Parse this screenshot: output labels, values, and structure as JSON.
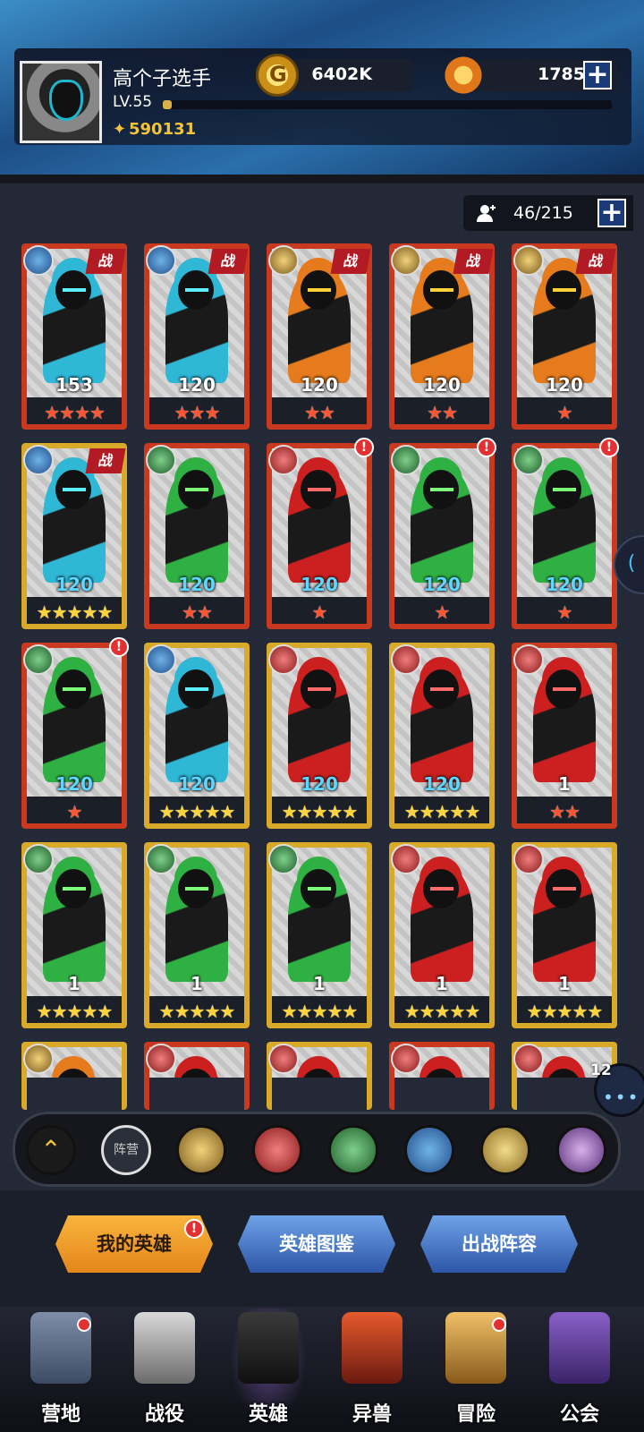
{
  "player": {
    "name": "高个子选手",
    "level": "LV.55",
    "xp_fraction": 0.02,
    "power": "590131"
  },
  "currencies": {
    "gold": "6402K",
    "gems": "1785"
  },
  "roster": {
    "capacity": "46/215"
  },
  "heroes": [
    {
      "level": "153",
      "stars": 4,
      "star_color": "red",
      "faction": "water",
      "battle": true,
      "alert": false,
      "frame": "red",
      "theme": "cyan"
    },
    {
      "level": "120",
      "stars": 3,
      "star_color": "red",
      "faction": "water",
      "battle": true,
      "alert": false,
      "frame": "red",
      "theme": "cyan"
    },
    {
      "level": "120",
      "stars": 2,
      "star_color": "red",
      "faction": "sun",
      "battle": true,
      "alert": false,
      "frame": "red",
      "theme": "orange"
    },
    {
      "level": "120",
      "stars": 2,
      "star_color": "red",
      "faction": "sun",
      "battle": true,
      "alert": false,
      "frame": "red",
      "theme": "orange"
    },
    {
      "level": "120",
      "stars": 1,
      "star_color": "red",
      "faction": "sun",
      "battle": true,
      "alert": false,
      "frame": "red",
      "theme": "orange"
    },
    {
      "level": "120",
      "stars": 5,
      "star_color": "gold",
      "faction": "water",
      "battle": true,
      "alert": false,
      "frame": "gold",
      "theme": "cyan"
    },
    {
      "level": "120",
      "stars": 2,
      "star_color": "red",
      "faction": "nature",
      "battle": false,
      "alert": false,
      "frame": "red",
      "theme": "green"
    },
    {
      "level": "120",
      "stars": 1,
      "star_color": "red",
      "faction": "fire",
      "battle": false,
      "alert": true,
      "frame": "red",
      "theme": "red"
    },
    {
      "level": "120",
      "stars": 1,
      "star_color": "red",
      "faction": "nature",
      "battle": false,
      "alert": true,
      "frame": "red",
      "theme": "green"
    },
    {
      "level": "120",
      "stars": 1,
      "star_color": "red",
      "faction": "nature",
      "battle": false,
      "alert": true,
      "frame": "red",
      "theme": "green"
    },
    {
      "level": "120",
      "stars": 1,
      "star_color": "red",
      "faction": "nature",
      "battle": false,
      "alert": true,
      "frame": "red",
      "theme": "green"
    },
    {
      "level": "120",
      "stars": 5,
      "star_color": "gold",
      "faction": "water",
      "battle": false,
      "alert": false,
      "frame": "gold",
      "theme": "cyan"
    },
    {
      "level": "120",
      "stars": 5,
      "star_color": "gold",
      "faction": "fire",
      "battle": false,
      "alert": false,
      "frame": "gold",
      "theme": "red"
    },
    {
      "level": "120",
      "stars": 5,
      "star_color": "gold",
      "faction": "fire",
      "battle": false,
      "alert": false,
      "frame": "gold",
      "theme": "red"
    },
    {
      "level": "1",
      "stars": 2,
      "star_color": "red",
      "faction": "fire",
      "battle": false,
      "alert": false,
      "frame": "red",
      "theme": "red"
    },
    {
      "level": "1",
      "stars": 5,
      "star_color": "gold",
      "faction": "nature",
      "battle": false,
      "alert": false,
      "frame": "gold",
      "theme": "green"
    },
    {
      "level": "1",
      "stars": 5,
      "star_color": "gold",
      "faction": "nature",
      "battle": false,
      "alert": false,
      "frame": "gold",
      "theme": "green"
    },
    {
      "level": "1",
      "stars": 5,
      "star_color": "gold",
      "faction": "nature",
      "battle": false,
      "alert": false,
      "frame": "gold",
      "theme": "green"
    },
    {
      "level": "1",
      "stars": 5,
      "star_color": "gold",
      "faction": "fire",
      "battle": false,
      "alert": false,
      "frame": "gold",
      "theme": "red"
    },
    {
      "level": "1",
      "stars": 5,
      "star_color": "gold",
      "faction": "fire",
      "battle": false,
      "alert": false,
      "frame": "gold",
      "theme": "red"
    },
    {
      "level": "",
      "stars": 0,
      "star_color": "gold",
      "faction": "sun",
      "battle": false,
      "alert": false,
      "frame": "gold",
      "theme": "orange"
    },
    {
      "level": "",
      "stars": 0,
      "star_color": "red",
      "faction": "fire",
      "battle": false,
      "alert": false,
      "frame": "red",
      "theme": "red"
    },
    {
      "level": "",
      "stars": 0,
      "star_color": "gold",
      "faction": "fire",
      "battle": false,
      "alert": false,
      "frame": "gold",
      "theme": "red"
    },
    {
      "level": "",
      "stars": 0,
      "star_color": "red",
      "faction": "fire",
      "battle": false,
      "alert": false,
      "frame": "red",
      "theme": "red"
    },
    {
      "level": "",
      "stars": 0,
      "star_color": "gold",
      "faction": "fire",
      "battle": false,
      "alert": false,
      "frame": "gold",
      "theme": "red"
    }
  ],
  "battle_label": "战",
  "filters": {
    "all_label": "阵营",
    "items": [
      "sun",
      "fire",
      "nature",
      "water",
      "holy",
      "dark"
    ]
  },
  "chat": {
    "count": "12"
  },
  "tabs": [
    {
      "label": "我的英雄",
      "active": true
    },
    {
      "label": "英雄图鉴",
      "active": false
    },
    {
      "label": "出战阵容",
      "active": false
    }
  ],
  "nav": [
    {
      "label": "营地",
      "icon": "camp-icon",
      "dot": true,
      "active": false
    },
    {
      "label": "战役",
      "icon": "crossed-swords-icon",
      "dot": false,
      "active": false
    },
    {
      "label": "英雄",
      "icon": "helmet-icon",
      "dot": false,
      "active": true
    },
    {
      "label": "异兽",
      "icon": "beast-icon",
      "dot": false,
      "active": false
    },
    {
      "label": "冒险",
      "icon": "compass-icon",
      "dot": true,
      "active": false
    },
    {
      "label": "公会",
      "icon": "guild-banner-icon",
      "dot": false,
      "active": false
    }
  ],
  "colors": {
    "frame_red": "#c8391f",
    "frame_gold": "#d9a92a",
    "level_cyan": "#5fd6ff",
    "level_white": "#ffffff"
  }
}
